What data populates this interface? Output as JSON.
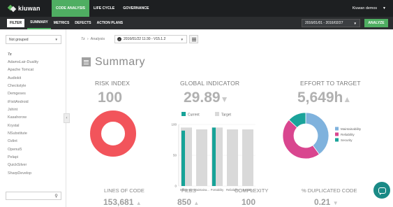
{
  "app": {
    "logo_text": "kiuwan",
    "top_nav": [
      {
        "label": "Code Analysis",
        "active": true
      },
      {
        "label": "Life Cycle",
        "active": false
      },
      {
        "label": "Governance",
        "active": false
      }
    ],
    "user_label": "Kiuwan demos",
    "accent_color": "#4fae62"
  },
  "subbar": {
    "filter_label": "Filter",
    "tabs": [
      {
        "label": "Summary",
        "active": true
      },
      {
        "label": "Metrics",
        "active": false
      },
      {
        "label": "Defects",
        "active": false
      },
      {
        "label": "Action Plans",
        "active": false
      }
    ],
    "date_range": "2016/01/01 - 2016/02/27",
    "analyze_label": "Analyze"
  },
  "sidebar": {
    "group_select_value": "Not grouped",
    "apps": [
      "7z",
      "AdamsLair-Duality",
      "Apache Tomcat",
      "Audiokit",
      "Checkstyle",
      "Demgeses",
      "iFixitAndroid",
      "Jshint",
      "Kasahorow",
      "Krystal",
      "NSubstitute",
      "Ozlint",
      "Openui5",
      "Pelapi",
      "QuickSilver",
      "SharpDevelop"
    ],
    "active_app": "7z",
    "search_icon": "search-icon",
    "collapse_icon": "chevron-left-icon"
  },
  "main": {
    "breadcrumb": {
      "app": "7z",
      "section": "Analysis",
      "separator": "›"
    },
    "snapshot_value": "2016/01/22 11:30 - V15.1.2",
    "list_icon": "list-icon",
    "title": "Summary",
    "risk_index": {
      "label": "Risk Index",
      "value": "100"
    },
    "global_indicator": {
      "label": "Global Indicator",
      "value": "29.89",
      "trend": "down"
    },
    "effort_to_target": {
      "label": "Effort to Target",
      "value": "5,649h",
      "trend": "up"
    },
    "metrics": [
      {
        "label": "Lines of Code",
        "value": "153,681",
        "trend": "up"
      },
      {
        "label": "Files",
        "value": "850",
        "trend": "up"
      },
      {
        "label": "Complexity",
        "value": "100",
        "trend": null
      },
      {
        "label": "% Duplicated Code",
        "value": "0.21",
        "trend": "down"
      }
    ],
    "chat_icon": "chat-icon"
  },
  "chart_data": [
    {
      "type": "pie",
      "labels": [
        "Risk"
      ],
      "values": [
        100
      ],
      "colors": [
        "#f2545b"
      ]
    },
    {
      "type": "bar",
      "categories": [
        "Efficiency",
        "Maintainability",
        "Portability",
        "Reliability",
        "Security"
      ],
      "category_labels": [
        "Efficiency",
        "Maintaina...",
        "Portability",
        "Reliability",
        "Security"
      ],
      "series": [
        {
          "name": "Current",
          "values": [
            90,
            0,
            95,
            0,
            0
          ],
          "color": "#17a398"
        },
        {
          "name": "Target",
          "values": [
            95,
            92,
            95,
            92,
            92
          ],
          "color": "#d9d9d9"
        }
      ],
      "ylim": [
        0,
        100
      ],
      "yticks": [
        0,
        50,
        100
      ],
      "legend": "top"
    },
    {
      "type": "pie",
      "labels": [
        "Maintainability",
        "Reliability",
        "Security"
      ],
      "values": [
        40,
        47,
        13
      ],
      "colors": [
        "#7fb2dd",
        "#d9468f",
        "#1aa39a"
      ],
      "legend": "right"
    }
  ]
}
